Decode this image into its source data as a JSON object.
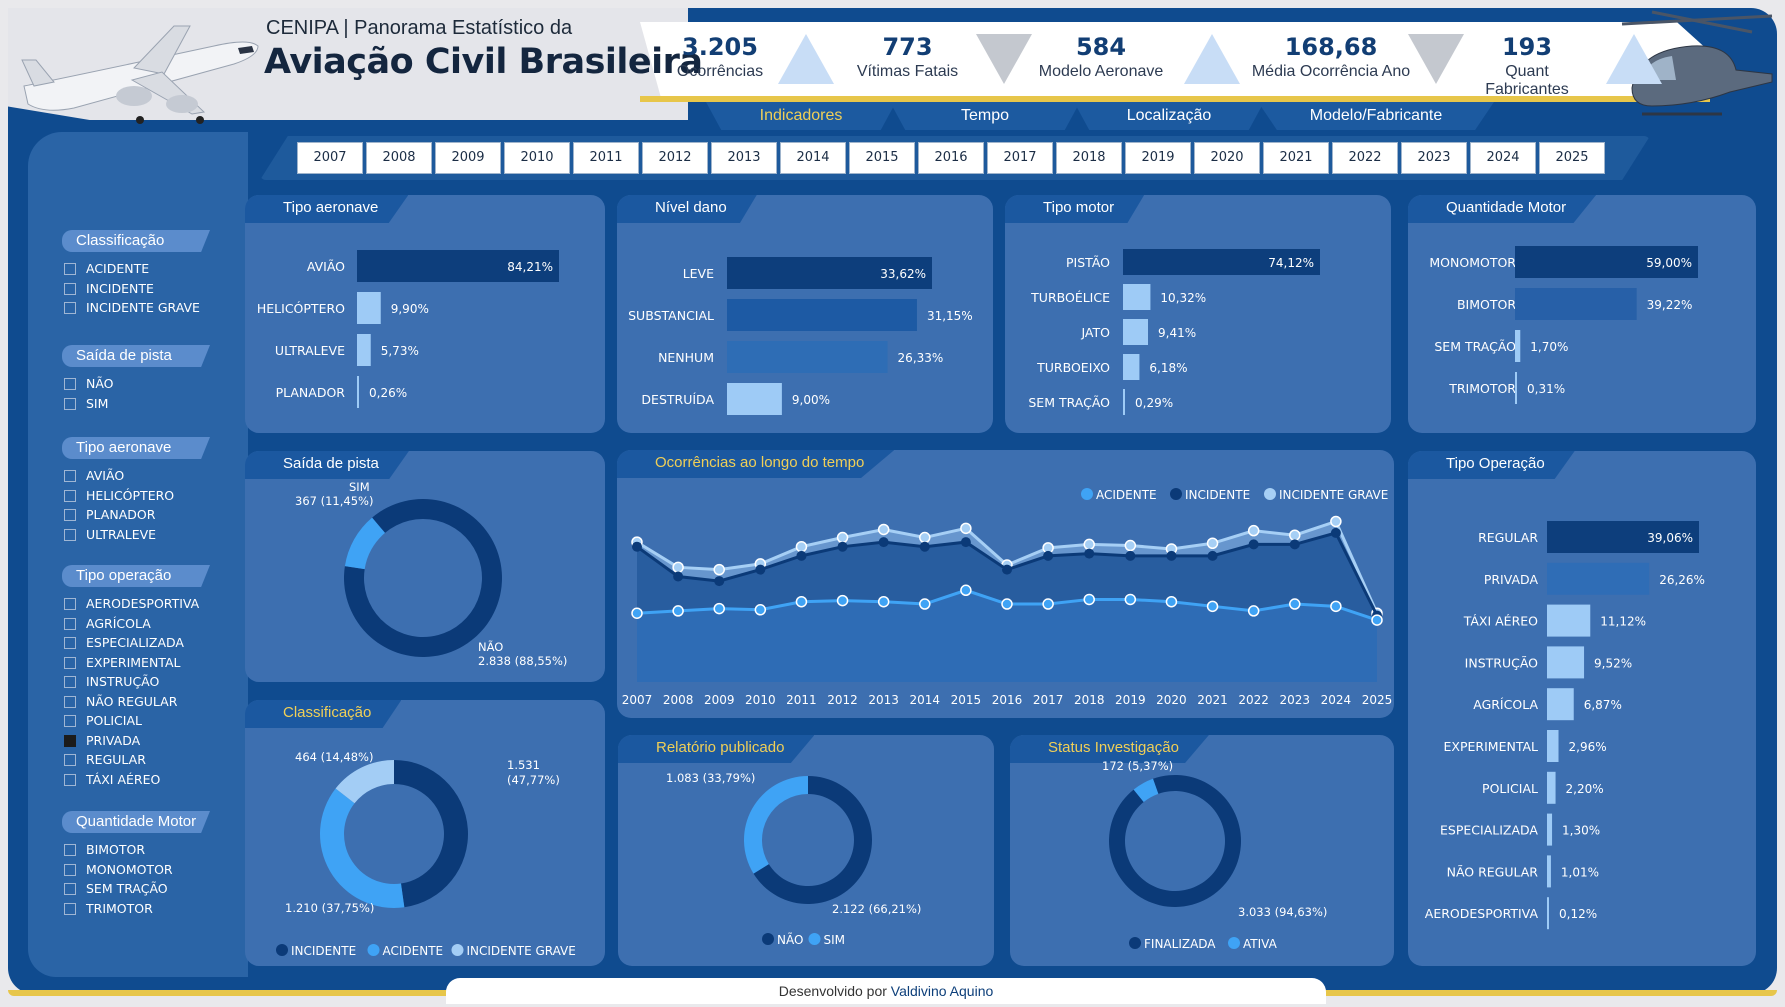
{
  "header": {
    "subtitle": "CENIPA | Panorama Estatístico da",
    "title": "Aviação Civil Brasileira"
  },
  "kpis": [
    {
      "value": "3.205",
      "label": "Ocorrências",
      "trend": "up"
    },
    {
      "value": "773",
      "label": "Vítimas Fatais",
      "trend": "down"
    },
    {
      "value": "584",
      "label": "Modelo Aeronave",
      "trend": "up"
    },
    {
      "value": "168,68",
      "label": "Média Ocorrência Ano",
      "trend": "down"
    },
    {
      "value": "193",
      "label": "Quant Fabricantes",
      "trend": "up"
    }
  ],
  "tabs": [
    {
      "label": "Indicadores",
      "active": true
    },
    {
      "label": "Tempo",
      "active": false
    },
    {
      "label": "Localização",
      "active": false
    },
    {
      "label": "Modelo/Fabricante",
      "active": false
    }
  ],
  "years": [
    "2007",
    "2008",
    "2009",
    "2010",
    "2011",
    "2012",
    "2013",
    "2014",
    "2015",
    "2016",
    "2017",
    "2018",
    "2019",
    "2020",
    "2021",
    "2022",
    "2023",
    "2024",
    "2025"
  ],
  "filters": [
    {
      "title": "Classificação",
      "items": [
        {
          "label": "ACIDENTE",
          "checked": false
        },
        {
          "label": "INCIDENTE",
          "checked": false
        },
        {
          "label": "INCIDENTE GRAVE",
          "checked": false
        }
      ]
    },
    {
      "title": "Saída de pista",
      "items": [
        {
          "label": "NÃO",
          "checked": false
        },
        {
          "label": "SIM",
          "checked": false
        }
      ]
    },
    {
      "title": "Tipo aeronave",
      "items": [
        {
          "label": "AVIÃO",
          "checked": false
        },
        {
          "label": "HELICÓPTERO",
          "checked": false
        },
        {
          "label": "PLANADOR",
          "checked": false
        },
        {
          "label": "ULTRALEVE",
          "checked": false
        }
      ]
    },
    {
      "title": "Tipo operação",
      "items": [
        {
          "label": "AERODESPORTIVA",
          "checked": false
        },
        {
          "label": "AGRÍCOLA",
          "checked": false
        },
        {
          "label": "ESPECIALIZADA",
          "checked": false
        },
        {
          "label": "EXPERIMENTAL",
          "checked": false
        },
        {
          "label": "INSTRUÇÃO",
          "checked": false
        },
        {
          "label": "NÃO REGULAR",
          "checked": false
        },
        {
          "label": "POLICIAL",
          "checked": false
        },
        {
          "label": "PRIVADA",
          "checked": true
        },
        {
          "label": "REGULAR",
          "checked": false
        },
        {
          "label": "TÁXI AÉREO",
          "checked": false
        }
      ]
    },
    {
      "title": "Quantidade Motor",
      "items": [
        {
          "label": "BIMOTOR",
          "checked": false
        },
        {
          "label": "MONOMOTOR",
          "checked": false
        },
        {
          "label": "SEM TRAÇÃO",
          "checked": false
        },
        {
          "label": "TRIMOTOR",
          "checked": false
        }
      ]
    }
  ],
  "cards": {
    "tipo_aeronave": "Tipo aeronave",
    "nivel_dano": "Nível dano",
    "tipo_motor": "Tipo motor",
    "quantidade_motor": "Quantidade Motor",
    "saida_pista": "Saída de pista",
    "ocorrencias_tempo": "Ocorrências ao longo do tempo",
    "tipo_operacao": "Tipo Operação",
    "classificacao": "Classificação",
    "relatorio": "Relatório publicado",
    "status": "Status Investigação"
  },
  "colors": {
    "dark": "#0d3e7c",
    "mid": "#2f6fb8",
    "light": "#9ecbf6",
    "accent": "#3fa3f5",
    "gold": "#f0cf57"
  },
  "chart_data": [
    {
      "id": "tipo_aeronave",
      "type": "bar",
      "orientation": "horizontal",
      "title": "Tipo aeronave",
      "categories": [
        "AVIÃO",
        "HELICÓPTERO",
        "ULTRALEVE",
        "PLANADOR"
      ],
      "values": [
        84.21,
        9.9,
        5.73,
        0.26
      ],
      "labels": [
        "84,21%",
        "9,90%",
        "5,73%",
        "0,26%"
      ]
    },
    {
      "id": "nivel_dano",
      "type": "bar",
      "orientation": "horizontal",
      "title": "Nível dano",
      "categories": [
        "LEVE",
        "SUBSTANCIAL",
        "NENHUM",
        "DESTRUÍDA"
      ],
      "values": [
        33.62,
        31.15,
        26.33,
        9.0
      ],
      "labels": [
        "33,62%",
        "31,15%",
        "26,33%",
        "9,00%"
      ]
    },
    {
      "id": "tipo_motor",
      "type": "bar",
      "orientation": "horizontal",
      "title": "Tipo motor",
      "categories": [
        "PISTÃO",
        "TURBOÉLICE",
        "JATO",
        "TURBOEIXO",
        "SEM TRAÇÃO"
      ],
      "values": [
        74.12,
        10.32,
        9.41,
        6.18,
        0.29
      ],
      "labels": [
        "74,12%",
        "10,32%",
        "9,41%",
        "6,18%",
        "0,29%"
      ]
    },
    {
      "id": "quantidade_motor",
      "type": "bar",
      "orientation": "horizontal",
      "title": "Quantidade Motor",
      "categories": [
        "MONOMOTOR",
        "BIMOTOR",
        "SEM TRAÇÃO",
        "TRIMOTOR"
      ],
      "values": [
        59.0,
        39.22,
        1.7,
        0.31
      ],
      "labels": [
        "59,00%",
        "39,22%",
        "1,70%",
        "0,31%"
      ]
    },
    {
      "id": "tipo_operacao",
      "type": "bar",
      "orientation": "horizontal",
      "title": "Tipo Operação",
      "categories": [
        "REGULAR",
        "PRIVADA",
        "TÁXI AÉREO",
        "INSTRUÇÃO",
        "AGRÍCOLA",
        "EXPERIMENTAL",
        "POLICIAL",
        "ESPECIALIZADA",
        "NÃO REGULAR",
        "AERODESPORTIVA"
      ],
      "values": [
        39.06,
        26.26,
        11.12,
        9.52,
        6.87,
        2.96,
        2.2,
        1.3,
        1.01,
        0.12
      ],
      "labels": [
        "39,06%",
        "26,26%",
        "11,12%",
        "9,52%",
        "6,87%",
        "2,96%",
        "2,20%",
        "1,30%",
        "1,01%",
        "0,12%"
      ]
    },
    {
      "id": "saida_pista",
      "type": "pie",
      "title": "Saída de pista",
      "slices": [
        {
          "name": "NÃO",
          "value": 2838,
          "label": "2.838 (88,55%)"
        },
        {
          "name": "SIM",
          "value": 367,
          "label": "367 (11,45%)"
        }
      ]
    },
    {
      "id": "classificacao",
      "type": "pie",
      "title": "Classificação",
      "slices": [
        {
          "name": "INCIDENTE",
          "value": 1531,
          "label": "1.531 (47,77%)"
        },
        {
          "name": "ACIDENTE",
          "value": 1210,
          "label": "1.210 (37,75%)"
        },
        {
          "name": "INCIDENTE GRAVE",
          "value": 464,
          "label": "464 (14,48%)"
        }
      ],
      "legend": [
        "INCIDENTE",
        "ACIDENTE",
        "INCIDENTE GRAVE"
      ]
    },
    {
      "id": "relatorio",
      "type": "pie",
      "title": "Relatório publicado",
      "slices": [
        {
          "name": "SIM",
          "value": 2122,
          "label": "2.122 (66,21%)"
        },
        {
          "name": "NÃO",
          "value": 1083,
          "label": "1.083 (33,79%)"
        }
      ],
      "legend": [
        "NÃO",
        "SIM"
      ]
    },
    {
      "id": "status",
      "type": "pie",
      "title": "Status Investigação",
      "slices": [
        {
          "name": "FINALIZADA",
          "value": 3033,
          "label": "3.033 (94,63%)"
        },
        {
          "name": "ATIVA",
          "value": 172,
          "label": "172 (5,37%)"
        }
      ],
      "legend": [
        "FINALIZADA",
        "ATIVA"
      ]
    },
    {
      "id": "ocorrencias_tempo",
      "type": "area",
      "title": "Ocorrências ao longo do tempo",
      "x": [
        "2007",
        "2008",
        "2009",
        "2010",
        "2011",
        "2012",
        "2013",
        "2014",
        "2015",
        "2016",
        "2017",
        "2018",
        "2019",
        "2020",
        "2021",
        "2022",
        "2023",
        "2024",
        "2025"
      ],
      "legend_position": "top-right",
      "series": [
        {
          "name": "ACIDENTE",
          "values": [
            60,
            62,
            64,
            63,
            70,
            71,
            70,
            68,
            80,
            68,
            68,
            72,
            72,
            70,
            66,
            62,
            68,
            66,
            54
          ]
        },
        {
          "name": "INCIDENTE",
          "values": [
            118,
            92,
            88,
            98,
            110,
            118,
            122,
            118,
            122,
            98,
            110,
            112,
            110,
            110,
            110,
            120,
            120,
            130,
            58
          ]
        },
        {
          "name": "INCIDENTE GRAVE",
          "values": [
            122,
            100,
            98,
            103,
            118,
            126,
            133,
            126,
            134,
            102,
            117,
            120,
            119,
            116,
            121,
            132,
            128,
            140,
            60
          ]
        }
      ]
    }
  ],
  "footer": {
    "prefix": "Desenvolvido por",
    "author": "Valdivino Aquino"
  }
}
